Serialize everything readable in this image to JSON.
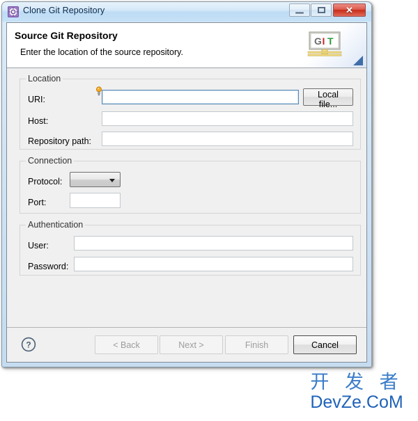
{
  "window": {
    "title": "Clone Git Repository",
    "icon": "git-repository-icon",
    "controls": {
      "minimize": "minimize-icon",
      "maximize": "maximize-icon",
      "close_label": "✕"
    }
  },
  "header": {
    "title": "Source Git Repository",
    "description": "Enter the location of the source repository.",
    "logo": {
      "letters": [
        "G",
        "I",
        "T"
      ],
      "colors": [
        "#6b6b6b",
        "#cc2127",
        "#2e9b3f"
      ]
    }
  },
  "groups": {
    "location": {
      "legend": "Location",
      "fields": [
        {
          "label": "URI:",
          "value": "",
          "placeholder": "",
          "focused": true,
          "decoration": "content-assist-lightbulb-icon"
        },
        {
          "label": "Host:",
          "value": "",
          "placeholder": ""
        },
        {
          "label": "Repository path:",
          "value": "",
          "placeholder": ""
        }
      ],
      "browse_button": "Local file..."
    },
    "connection": {
      "legend": "Connection",
      "protocol": {
        "label": "Protocol:",
        "value": ""
      },
      "port": {
        "label": "Port:",
        "value": "",
        "placeholder": ""
      }
    },
    "authentication": {
      "legend": "Authentication",
      "user": {
        "label": "User:",
        "value": "",
        "placeholder": ""
      },
      "password": {
        "label": "Password:",
        "value": "",
        "placeholder": ""
      }
    }
  },
  "buttonbar": {
    "help": "?",
    "back": "< Back",
    "next": "Next >",
    "finish": "Finish",
    "cancel": "Cancel"
  },
  "watermark": {
    "chinese": "开 发 者",
    "latin": "DevZe.CoM"
  }
}
